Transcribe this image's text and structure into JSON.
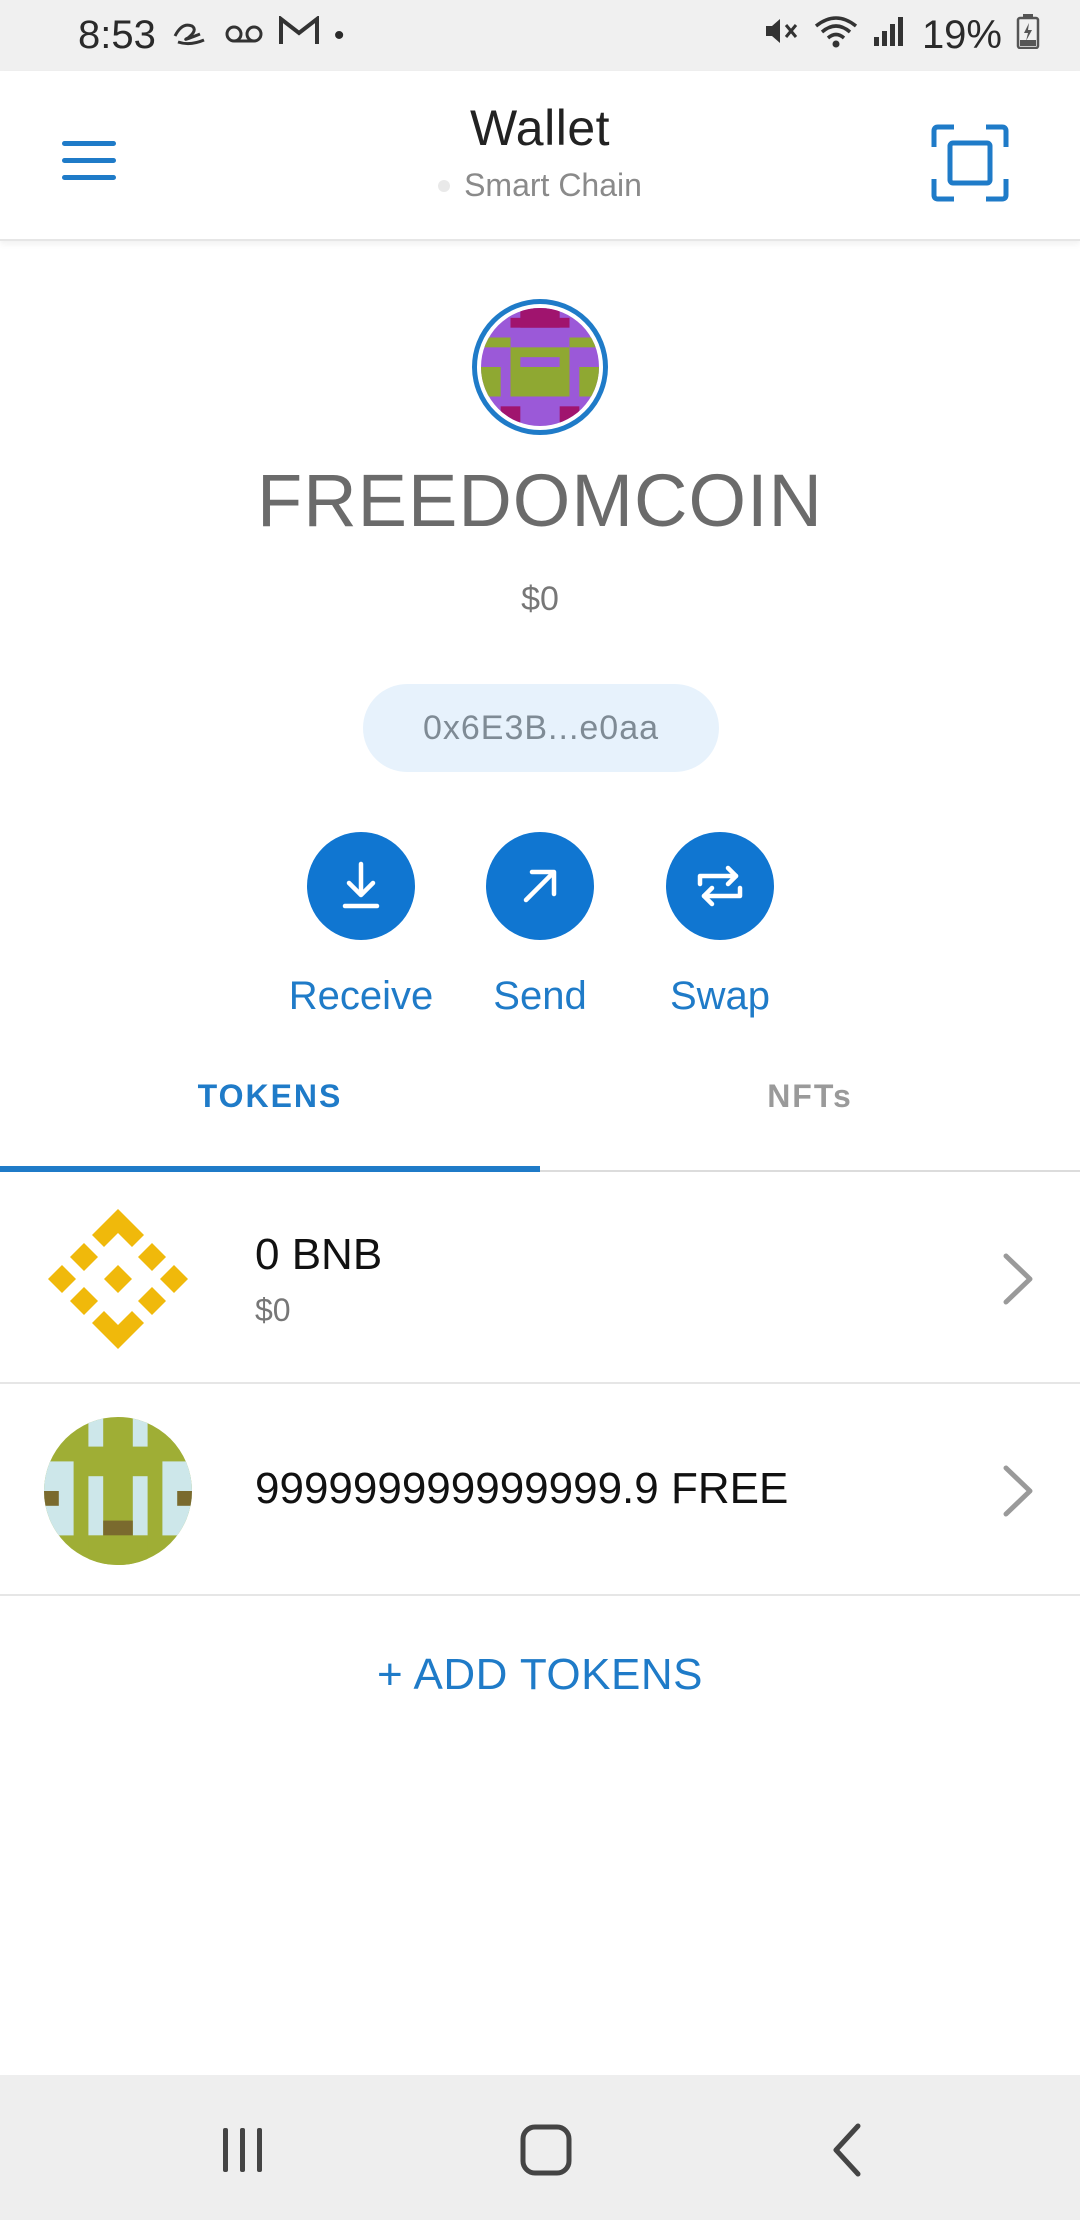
{
  "status_bar": {
    "time": "8:53",
    "notification_icons": [
      "amazon-icon",
      "voicemail-icon",
      "gmail-icon",
      "dot-icon"
    ],
    "system_icons": [
      "mute-icon",
      "wifi-icon",
      "signal-icon"
    ],
    "battery": "19%"
  },
  "header": {
    "title": "Wallet",
    "network": "Smart Chain"
  },
  "account": {
    "name": "FREEDOMCOIN",
    "balance": "$0",
    "address": "0x6E3B...e0aa"
  },
  "actions": [
    {
      "label": "Receive",
      "icon": "receive-icon"
    },
    {
      "label": "Send",
      "icon": "send-icon"
    },
    {
      "label": "Swap",
      "icon": "swap-icon"
    }
  ],
  "tabs": [
    {
      "label": "TOKENS",
      "active": true
    },
    {
      "label": "NFTs",
      "active": false
    }
  ],
  "tokens": [
    {
      "amount": "0 BNB",
      "value": "$0",
      "icon": "bnb-icon"
    },
    {
      "amount": "999999999999999.9 FREE",
      "value": "",
      "icon": "identicon"
    }
  ],
  "add_tokens_label": "+ ADD TOKENS",
  "colors": {
    "accent": "#1f7bc8",
    "action_button": "#1076d1",
    "bnb_yellow": "#f0b90b",
    "address_pill_bg": "#e7f2fc"
  },
  "nav_bar": [
    "recents-icon",
    "home-icon",
    "back-icon"
  ]
}
